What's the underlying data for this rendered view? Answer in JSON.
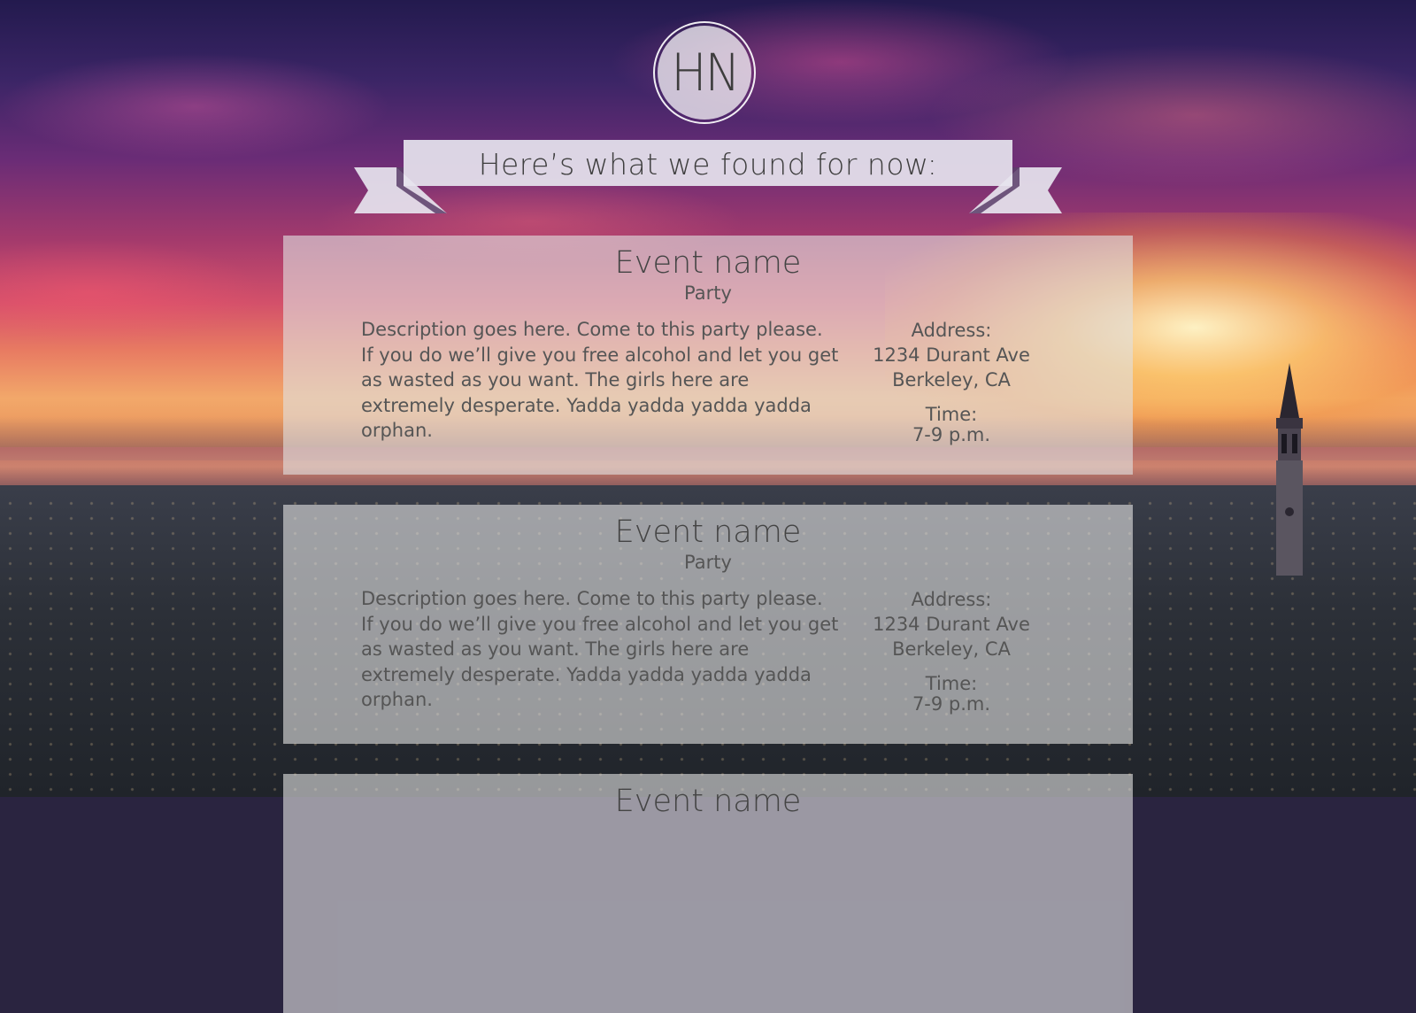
{
  "logo": {
    "text": "HN"
  },
  "banner": {
    "text": "Here’s what we found for now:"
  },
  "events": [
    {
      "name": "Event name",
      "type": "Party",
      "description": "Description goes here. Come to this party please. If you do we’ll give you free alcohol and let you get as wasted as you want. The girls here are extremely desperate. Yadda yadda yadda yadda orphan.",
      "address_label": "Address:",
      "address_line1": "1234 Durant Ave",
      "address_line2": "Berkeley, CA",
      "time_label": "Time:",
      "time_value": "7-9 p.m."
    },
    {
      "name": "Event name",
      "type": "Party",
      "description": "Description goes here. Come to this party please. If you do we’ll give you free alcohol and let you get as wasted as you want. The girls here are extremely desperate. Yadda yadda yadda yadda orphan.",
      "address_label": "Address:",
      "address_line1": "1234 Durant Ave",
      "address_line2": "Berkeley, CA",
      "time_label": "Time:",
      "time_value": "7-9 p.m."
    },
    {
      "name": "Event name",
      "type": "",
      "description": "",
      "address_label": "",
      "address_line1": "",
      "address_line2": "",
      "time_label": "",
      "time_value": ""
    }
  ],
  "colors": {
    "card_background": "#e1e1e1",
    "text": "#555555",
    "heading_text": "#444444",
    "ribbon": "#e6e4ee"
  }
}
